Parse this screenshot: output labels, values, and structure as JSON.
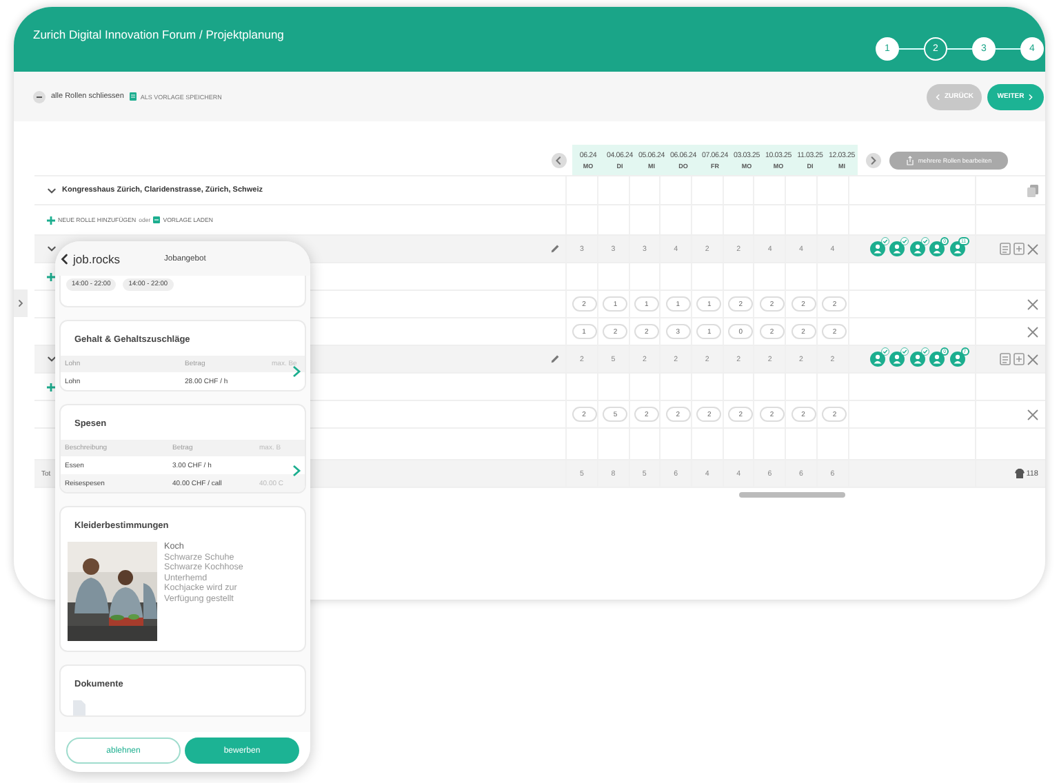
{
  "window": {
    "title": "Zurich Digital Innovation Forum / Projektplanung"
  },
  "stepper": [
    {
      "label": "1",
      "selected": false
    },
    {
      "label": "2",
      "selected": true
    },
    {
      "label": "3",
      "selected": false
    },
    {
      "label": "4",
      "selected": false
    }
  ],
  "toolbar": {
    "collapse_all": "alle Rollen schliessen",
    "save_template": "ALS VORLAGE SPEICHERN",
    "back": "ZURÜCK",
    "next": "WEITER"
  },
  "table": {
    "dates": [
      {
        "date": "06.24",
        "day": "MO"
      },
      {
        "date": "04.06.24",
        "day": "DI"
      },
      {
        "date": "05.06.24",
        "day": "MI"
      },
      {
        "date": "06.06.24",
        "day": "DO"
      },
      {
        "date": "07.06.24",
        "day": "FR"
      },
      {
        "date": "03.03.25",
        "day": "MO"
      },
      {
        "date": "10.03.25",
        "day": "MO"
      },
      {
        "date": "11.03.25",
        "day": "DI"
      },
      {
        "date": "12.03.25",
        "day": "MI"
      }
    ],
    "bulk_edit": "mehrere Rollen bearbeiten",
    "location": "Kongresshaus Zürich, Claridenstrasse, Zürich, Schweiz",
    "add_role": "NEUE ROLLE HINZUFÜGEN",
    "or": "oder",
    "load_template": "VORLAGE LADEN",
    "rows": [
      {
        "kind": "role",
        "values": [
          "3",
          "3",
          "3",
          "4",
          "2",
          "2",
          "4",
          "4",
          "4"
        ],
        "badges": [
          {
            "kind": "check"
          },
          {
            "kind": "check"
          },
          {
            "kind": "check"
          },
          {
            "kind": "count",
            "text": "0"
          },
          {
            "kind": "count",
            "text": "11"
          }
        ]
      },
      {
        "kind": "add"
      },
      {
        "kind": "shift",
        "values": [
          "2",
          "1",
          "1",
          "1",
          "1",
          "2",
          "2",
          "2",
          "2"
        ]
      },
      {
        "kind": "shift",
        "values": [
          "1",
          "2",
          "2",
          "3",
          "1",
          "0",
          "2",
          "2",
          "2"
        ]
      },
      {
        "kind": "role",
        "values": [
          "2",
          "5",
          "2",
          "2",
          "2",
          "2",
          "2",
          "2",
          "2"
        ],
        "badges": [
          {
            "kind": "check"
          },
          {
            "kind": "check"
          },
          {
            "kind": "check"
          },
          {
            "kind": "count",
            "text": "0"
          },
          {
            "kind": "count",
            "text": "7"
          }
        ]
      },
      {
        "kind": "add"
      },
      {
        "kind": "shift",
        "values": [
          "2",
          "5",
          "2",
          "2",
          "2",
          "2",
          "2",
          "2",
          "2"
        ]
      }
    ],
    "total": {
      "label": "Tot",
      "values": [
        "5",
        "8",
        "5",
        "6",
        "4",
        "4",
        "6",
        "6",
        "6"
      ],
      "count": "118"
    }
  },
  "phone": {
    "brand": "job.rocks",
    "title": "Jobangebot",
    "shifts": [
      "14:00 - 22:00",
      "14:00 - 22:00"
    ],
    "salary": {
      "title": "Gehalt & Gehaltszuschläge",
      "columns": [
        "Lohn",
        "Betrag",
        "max. Be"
      ],
      "rows": [
        [
          "Lohn",
          "28.00 CHF / h"
        ]
      ]
    },
    "expenses": {
      "title": "Spesen",
      "columns": [
        "Beschreibung",
        "Betrag",
        "max. B"
      ],
      "rows": [
        [
          "Essen",
          "3.00 CHF / h"
        ],
        [
          "Reisespesen",
          "40.00 CHF / call",
          "40.00 C"
        ]
      ]
    },
    "dress": {
      "title": "Kleiderbestimmungen",
      "role": "Koch",
      "items": [
        "Schwarze Schuhe",
        "Schwarze Kochhose",
        "Unterhemd",
        "Kochjacke wird zur Verfügung gestellt"
      ]
    },
    "documents": {
      "title": "Dokumente"
    },
    "decline": "ablehnen",
    "apply": "bewerben"
  }
}
